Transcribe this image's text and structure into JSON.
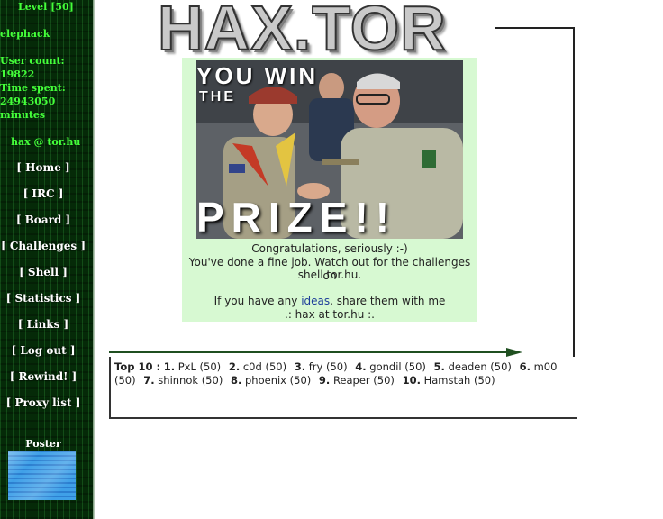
{
  "sidebar": {
    "level": "Level [50]",
    "username": "elephack",
    "user_count_label": "User count:",
    "user_count": "19822",
    "time_spent_label": "Time spent:",
    "time_spent_value": "24943050",
    "time_spent_unit": "minutes",
    "contact": "hax @ tor.hu",
    "nav": [
      "[ Home ]",
      "[ IRC ]",
      "[ Board ]",
      "[ Challenges ]",
      "[ Shell ]",
      "[ Statistics ]",
      "[ Links ]",
      "[ Log out ]",
      "[ Rewind! ]",
      "[ Proxy list ]"
    ],
    "poster_label": "Poster"
  },
  "logo": "HAX.TOR",
  "prize": {
    "image_top": "YOU WIN",
    "image_the": "THE",
    "image_bottom": "PRIZE!!",
    "line1": "Congratulations, seriously :-)",
    "line2": "You've done a fine job. Watch out for the challenges on",
    "line3": "shell.tor.hu.",
    "line4_pre": "If you have any ",
    "line4_link": "ideas",
    "line4_post": ", share them with me",
    "line5": ".: hax at tor.hu :."
  },
  "top10": {
    "label": "Top 10 :",
    "entries": [
      {
        "rank": "1.",
        "name": "PxL (50)"
      },
      {
        "rank": "2.",
        "name": "c0d (50)"
      },
      {
        "rank": "3.",
        "name": "fry (50)"
      },
      {
        "rank": "4.",
        "name": "gondil (50)"
      },
      {
        "rank": "5.",
        "name": "deaden (50)"
      },
      {
        "rank": "6.",
        "name": "m00 (50)"
      },
      {
        "rank": "7.",
        "name": "shinnok (50)"
      },
      {
        "rank": "8.",
        "name": "phoenix (50)"
      },
      {
        "rank": "9.",
        "name": "Reaper (50)"
      },
      {
        "rank": "10.",
        "name": "Hamstah (50)"
      }
    ]
  },
  "colors": {
    "sidebar_bg": "#052a08",
    "sidebar_text": "#44ff3a",
    "prize_box_bg": "#d7f9d2",
    "link": "#1f3f9a"
  }
}
